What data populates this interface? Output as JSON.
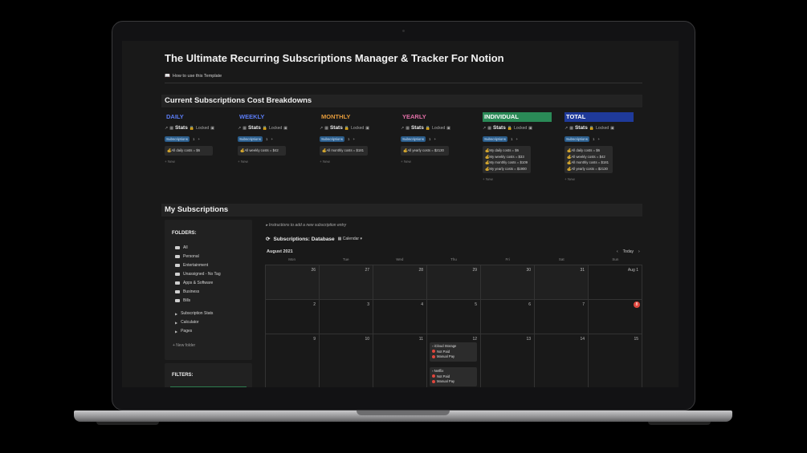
{
  "page": {
    "title": "The Ultimate Recurring Subscriptions Manager & Tracker For Notion",
    "howto_link": "How to use this Template"
  },
  "sections": {
    "breakdown": "Current Subscriptions Cost Breakdowns",
    "my_subs": "My Subscriptions"
  },
  "columns": [
    {
      "title": "DAILY",
      "color": "#5b7cf5",
      "bg": "#191919",
      "stats": "Stats",
      "locked": "Locked",
      "tab": "Subscriptions",
      "count": "1",
      "cards": [
        "All daily costs = $6"
      ],
      "new": "+ New"
    },
    {
      "title": "WEEKLY",
      "color": "#5b7cf5",
      "bg": "#191919",
      "stats": "Stats",
      "locked": "Locked",
      "tab": "Subscriptions",
      "count": "1",
      "cards": [
        "All weekly costs = $42"
      ],
      "new": "+ New"
    },
    {
      "title": "MONTHLY",
      "color": "#e39a3b",
      "bg": "#191919",
      "stats": "Stats",
      "locked": "Locked",
      "tab": "Subscriptions",
      "count": "1",
      "cards": [
        "All monthly costs = $181"
      ],
      "new": "+ New"
    },
    {
      "title": "YEARLY",
      "color": "#e06fa6",
      "bg": "#191919",
      "stats": "Stats",
      "locked": "Locked",
      "tab": "Subscriptions",
      "count": "1",
      "cards": [
        "All yearly costs = $2130"
      ],
      "new": "+ New"
    },
    {
      "title": "INDIVIDUAL",
      "color": "#ffffff",
      "bg": "#2a8a57",
      "stats": "Stats",
      "locked": "Locked",
      "tab": "Subscriptions",
      "count": "1",
      "cards": [
        "My daily costs = $6",
        "My weekly costs = $33",
        "My monthly costs = $109",
        "My yearly costs = $1900"
      ],
      "new": "+ New"
    },
    {
      "title": "TOTAL",
      "color": "#ffffff",
      "bg": "#1f3a9a",
      "stats": "Stats",
      "locked": "Locked",
      "tab": "Subscriptions",
      "count": "1",
      "cards": [
        "All daily costs = $6",
        "All weekly costs = $42",
        "All monthly costs = $181",
        "All yearly costs = $2130"
      ],
      "new": "+ New"
    }
  ],
  "sidebar": {
    "title": "FOLDERS:",
    "folders": [
      "All",
      "Personal",
      "Entertainment",
      "Unassigned - No Tag",
      "Apps & Software",
      "Business",
      "Bills"
    ],
    "toggles": [
      "Subscription Stats",
      "Calculator",
      "Pages"
    ],
    "new_folder": "+ New folder",
    "filters_title": "FILTERS:"
  },
  "database": {
    "instructions": "Instructions to add a new subscription entry",
    "title": "Subscriptions: Database",
    "view": "Calendar",
    "month": "August 2021",
    "today": "Today",
    "weekdays": [
      "Mon",
      "Tue",
      "Wed",
      "Thu",
      "Fri",
      "Sat",
      "Sun"
    ],
    "days": [
      "26",
      "27",
      "28",
      "29",
      "30",
      "31",
      "Aug 1",
      "2",
      "3",
      "4",
      "5",
      "6",
      "7",
      "8",
      "9",
      "10",
      "11",
      "12",
      "13",
      "14",
      "15"
    ],
    "events": [
      {
        "name": "iCloud Storage",
        "status": "Not Paid",
        "method": "Manual Pay"
      },
      {
        "name": "Netflix",
        "status": "Not Paid",
        "method": "Manual Pay"
      }
    ]
  }
}
